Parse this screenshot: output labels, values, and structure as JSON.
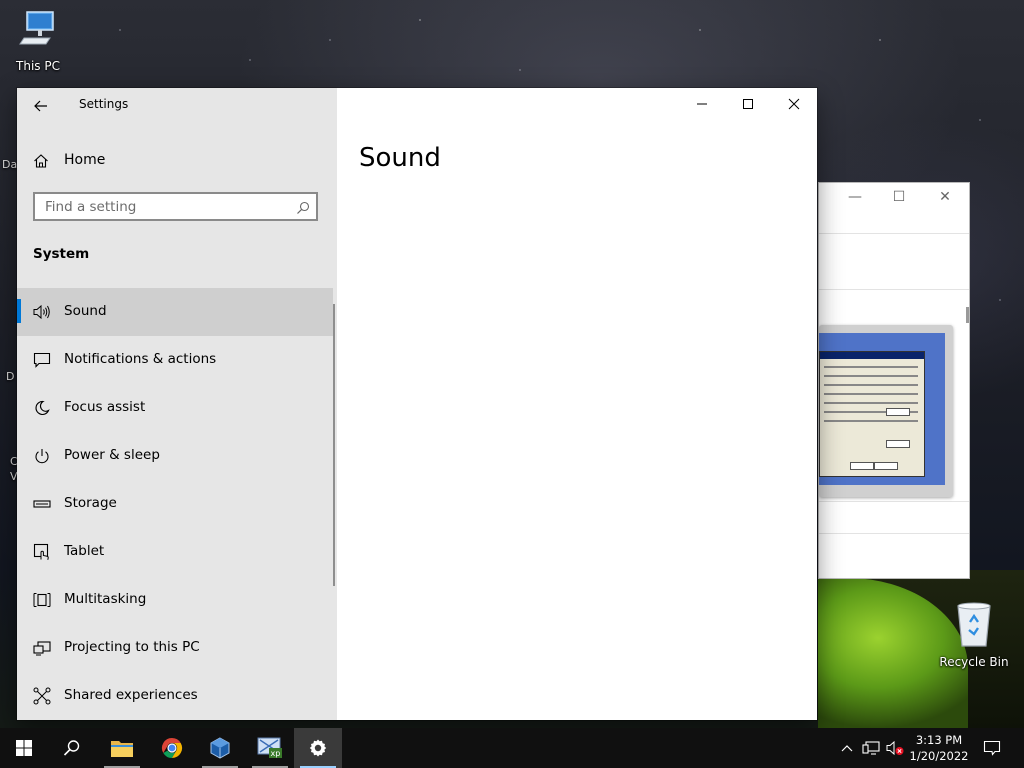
{
  "desktop": {
    "icons": [
      {
        "label": "This PC",
        "icon": "computer-icon"
      },
      {
        "label": "Recycle Bin",
        "icon": "recycle-bin-icon"
      }
    ]
  },
  "settings": {
    "app_title": "Settings",
    "home_label": "Home",
    "search": {
      "placeholder": "Find a setting",
      "value": ""
    },
    "section": "System",
    "page_title": "Sound",
    "nav_items": [
      {
        "label": "Sound",
        "icon": "speaker-icon",
        "selected": true
      },
      {
        "label": "Notifications & actions",
        "icon": "notification-icon"
      },
      {
        "label": "Focus assist",
        "icon": "moon-icon"
      },
      {
        "label": "Power & sleep",
        "icon": "power-icon"
      },
      {
        "label": "Storage",
        "icon": "storage-icon"
      },
      {
        "label": "Tablet",
        "icon": "tablet-icon"
      },
      {
        "label": "Multitasking",
        "icon": "multitasking-icon"
      },
      {
        "label": "Projecting to this PC",
        "icon": "projecting-icon"
      },
      {
        "label": "Shared experiences",
        "icon": "shared-experiences-icon"
      }
    ],
    "accent_color": "#0078d7"
  },
  "taskbar": {
    "apps": [
      "start-icon",
      "search-icon",
      "file-explorer-icon",
      "chrome-icon",
      "virtualbox-icon",
      "windows-xp-mode-icon",
      "settings-icon"
    ],
    "active_app": "settings-icon",
    "clock": {
      "time": "3:13 PM",
      "date": "1/20/2022"
    }
  }
}
